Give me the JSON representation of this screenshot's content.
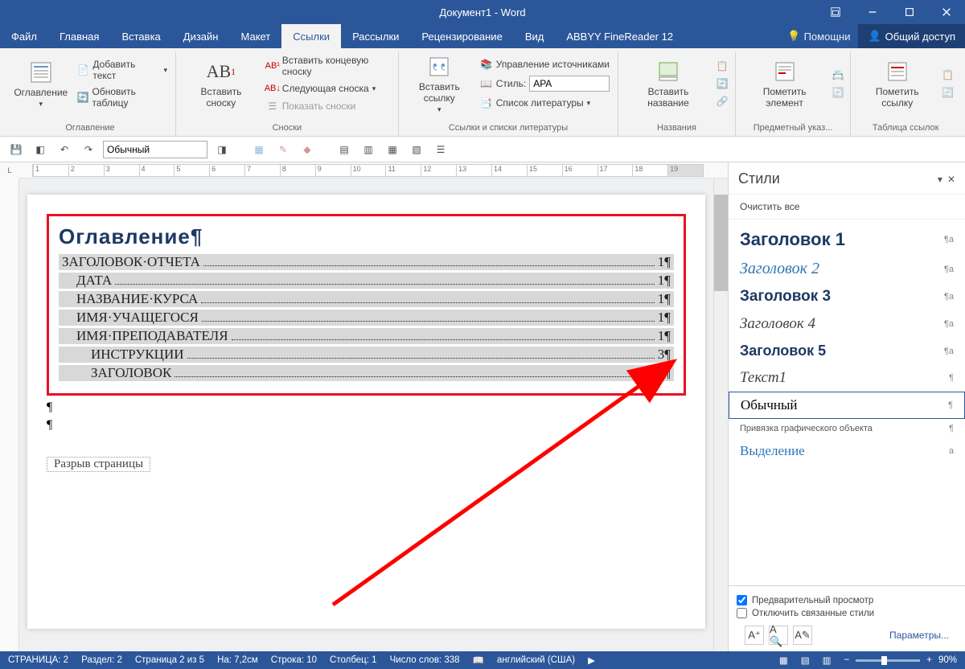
{
  "titlebar": {
    "title": "Документ1 - Word"
  },
  "tabs": {
    "file": "Файл",
    "home": "Главная",
    "insert": "Вставка",
    "design": "Дизайн",
    "layout": "Макет",
    "references": "Ссылки",
    "mailings": "Рассылки",
    "review": "Рецензирование",
    "view": "Вид",
    "abbyy": "ABBYY FineReader 12",
    "helper": "Помощни",
    "share": "Общий доступ"
  },
  "ribbon": {
    "toc_group": "Оглавление",
    "toc_btn": "Оглавление",
    "add_text": "Добавить текст",
    "update_table": "Обновить таблицу",
    "footnotes_group": "Сноски",
    "insert_footnote": "Вставить сноску",
    "insert_endnote": "Вставить концевую сноску",
    "next_footnote": "Следующая сноска",
    "show_notes": "Показать сноски",
    "citations_group": "Ссылки и списки литературы",
    "insert_citation": "Вставить ссылку",
    "manage_sources": "Управление источниками",
    "style_label": "Стиль:",
    "style_value": "APA",
    "bibliography": "Список литературы",
    "captions_group": "Названия",
    "insert_caption": "Вставить название",
    "index_group": "Предметный указ...",
    "mark_entry": "Пометить элемент",
    "toa_group": "Таблица ссылок",
    "mark_citation": "Пометить ссылку"
  },
  "qat": {
    "style_select": "Обычный"
  },
  "document": {
    "toc_heading": "Оглавление",
    "pilcrow": "¶",
    "entries": [
      {
        "text": "ЗАГОЛОВОК·ОТЧЕТА",
        "page": "1¶",
        "indent": 0
      },
      {
        "text": "ДАТА",
        "page": "1¶",
        "indent": 1
      },
      {
        "text": "НАЗВАНИЕ·КУРСА",
        "page": "1¶",
        "indent": 1
      },
      {
        "text": "ИМЯ·УЧАЩЕГОСЯ",
        "page": "1¶",
        "indent": 1
      },
      {
        "text": "ИМЯ·ПРЕПОДАВАТЕЛЯ",
        "page": "1¶",
        "indent": 1
      },
      {
        "text": "ИНСТРУКЦИИ",
        "page": "3¶",
        "indent": 2
      },
      {
        "text": "ЗАГОЛОВОК",
        "page": "4¶",
        "indent": 2
      }
    ],
    "page_break": "Разрыв страницы"
  },
  "styles_panel": {
    "title": "Стили",
    "clear_all": "Очистить все",
    "items": {
      "h1": "Заголовок 1",
      "h2": "Заголовок 2",
      "h3": "Заголовок 3",
      "h4": "Заголовок 4",
      "h5": "Заголовок 5",
      "text1": "Текст1",
      "normal": "Обычный",
      "anchor": "Привязка графического объекта",
      "highlight": "Выделение"
    },
    "sym_para": "¶а",
    "sym_p": "¶",
    "sym_a": "а",
    "preview": "Предварительный просмотр",
    "disable_linked": "Отключить связанные стили",
    "params": "Параметры..."
  },
  "statusbar": {
    "page": "СТРАНИЦА: 2",
    "section": "Раздел: 2",
    "page_of": "Страница 2 из 5",
    "at": "На: 7,2см",
    "line": "Строка: 10",
    "column": "Столбец: 1",
    "words": "Число слов: 338",
    "lang": "английский (США)",
    "zoom": "90%"
  }
}
